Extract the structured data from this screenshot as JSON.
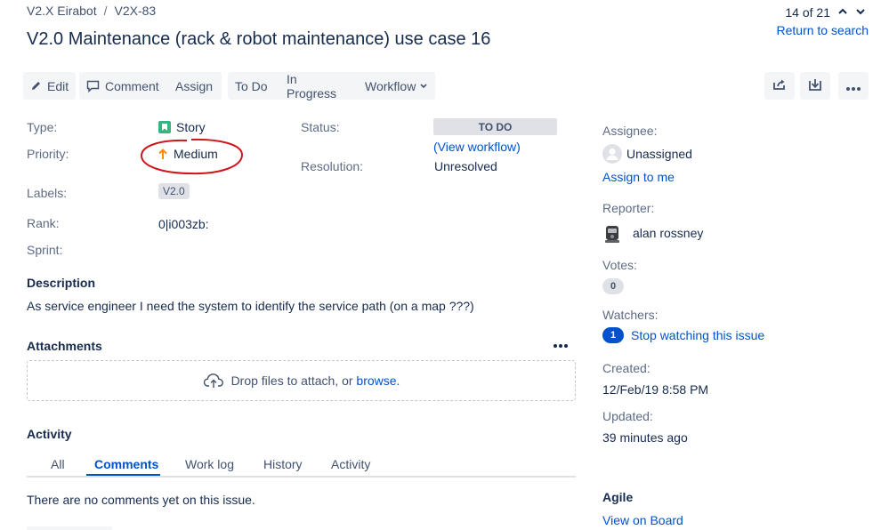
{
  "breadcrumb": {
    "project": "V2.X Eirabot",
    "issue_key": "V2X-83"
  },
  "title": "V2.0 Maintenance (rack & robot maintenance) use case 16",
  "pager": {
    "position": "14 of 21",
    "return_label": "Return to search"
  },
  "toolbar": {
    "edit": "Edit",
    "comment": "Comment",
    "assign": "Assign",
    "todo": "To Do",
    "in_progress": "In Progress",
    "workflow": "Workflow",
    "icons": [
      "share-icon",
      "export-icon",
      "more-icon"
    ]
  },
  "details": {
    "type_label": "Type:",
    "type_value": "Story",
    "priority_label": "Priority:",
    "priority_value": "Medium",
    "labels_label": "Labels:",
    "labels_value": "V2.0",
    "rank_label": "Rank:",
    "rank_value": "0|i003zb:",
    "sprint_label": "Sprint:",
    "status_label": "Status:",
    "status_value": "TO DO",
    "view_workflow": "(View workflow)",
    "resolution_label": "Resolution:",
    "resolution_value": "Unresolved"
  },
  "colors": {
    "accent": "#0052cc",
    "story_green": "#36b37e",
    "priority_orange": "#ff8b00",
    "annotation_red": "#d0161b"
  },
  "description": {
    "heading": "Description",
    "text": "As service engineer I need the system to identify the service path (on a map ???)"
  },
  "attachments": {
    "heading": "Attachments",
    "drop_text": "Drop files to attach, or ",
    "browse": "browse."
  },
  "activity": {
    "heading": "Activity",
    "tabs": [
      "All",
      "Comments",
      "Work log",
      "History",
      "Activity"
    ],
    "active_tab": "Comments",
    "empty_text": "There are no comments yet on this issue."
  },
  "people": {
    "assignee_label": "Assignee:",
    "assignee_value": "Unassigned",
    "assign_to_me": "Assign to me",
    "reporter_label": "Reporter:",
    "reporter_value": "alan rossney",
    "votes_label": "Votes:",
    "votes_count": "0",
    "watchers_label": "Watchers:",
    "watchers_count": "1",
    "stop_watching": "Stop watching this issue"
  },
  "dates": {
    "created_label": "Created:",
    "created_value": "12/Feb/19 8:58 PM",
    "updated_label": "Updated:",
    "updated_value": "39 minutes ago"
  },
  "agile": {
    "heading": "Agile",
    "view_on_board": "View on Board"
  }
}
